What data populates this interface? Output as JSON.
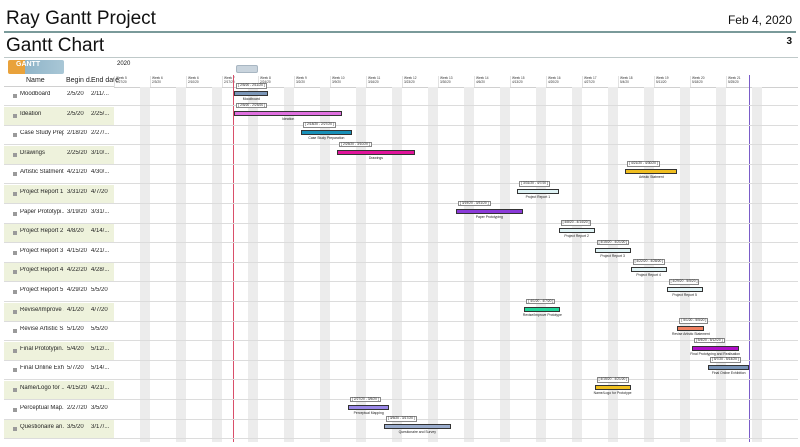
{
  "header": {
    "title": "Ray Gantt Project",
    "date": "Feb 4, 2020",
    "subtitle": "Gantt Chart",
    "page": "3"
  },
  "chart": {
    "logo_text": "GANTT",
    "year": "2020",
    "col_name": "Name",
    "col_begin": "Begin d...",
    "col_end": "End date",
    "weeks": [
      "Week 5",
      "Week 6",
      "Week 6",
      "Week 7",
      "Week 8",
      "Week 9",
      "Week 10",
      "Week 11",
      "Week 12",
      "Week 13",
      "Week 14",
      "Week 15",
      "Week 16",
      "Week 17",
      "Week 18",
      "Week 19",
      "Week 20",
      "Week 21"
    ],
    "week_dates": [
      "1/27/20",
      "2/3/20",
      "2/10/20",
      "2/17/20",
      "2/24/20",
      "3/2/20",
      "3/9/20",
      "3/16/20",
      "3/23/20",
      "3/30/20",
      "4/6/20",
      "4/13/20",
      "4/20/20",
      "4/27/20",
      "5/4/20",
      "5/11/20",
      "5/18/20",
      "5/25/20"
    ],
    "today_line_color": "#d94f6a",
    "end_line_color": "#7a5cc8",
    "tasks": [
      {
        "name": "Moodboard",
        "begin": "2/5/20",
        "end": "2/11/...",
        "range": "[ 2/5/20 - 2/11/20 ]",
        "label": "Moodboard",
        "color": "#7b96b8",
        "start": 3.34,
        "dur": 0.95
      },
      {
        "name": "Ideation",
        "begin": "2/5/20",
        "end": "2/25/...",
        "range": "[ 2/5/20 - 2/25/20 ]",
        "label": "Ideation",
        "color": "#e070e0",
        "start": 3.34,
        "dur": 3.0
      },
      {
        "name": "Case Study Prep...",
        "begin": "2/18/20",
        "end": "2/27/...",
        "range": "[ 2/18/20 - 2/27/20 ]",
        "label": "Case Study Preparation",
        "color": "#1890b8",
        "start": 5.2,
        "dur": 1.4
      },
      {
        "name": "Drawings",
        "begin": "2/25/20",
        "end": "3/10/...",
        "range": "[ 2/25/20 - 3/10/20 ]",
        "label": "Drawings",
        "color": "#e0139a",
        "start": 6.2,
        "dur": 2.15
      },
      {
        "name": "Artistic Statment",
        "begin": "4/21/20",
        "end": "4/30/...",
        "range": "[ 4/21/20 - 4/30/20 ]",
        "label": "Artistic Statment",
        "color": "#f0be20",
        "start": 14.2,
        "dur": 1.45
      },
      {
        "name": "Project Report 1",
        "begin": "3/31/20",
        "end": "4/7/20",
        "range": "[ 3/31/20 - 4/7/20 ]",
        "label": "Project Report 1",
        "color": "#dff3f5",
        "start": 11.2,
        "dur": 1.15
      },
      {
        "name": "Paper Prototypi...",
        "begin": "3/19/20",
        "end": "3/31/...",
        "range": "[ 3/19/20 - 3/31/20 ]",
        "label": "Paper Prototyping",
        "color": "#8a3ad8",
        "start": 9.5,
        "dur": 1.85
      },
      {
        "name": "Project Report 2",
        "begin": "4/8/20",
        "end": "4/14/...",
        "range": "[ 4/8/20 - 4/14/20 ]",
        "label": "Project Report 2",
        "color": "#dff3f5",
        "start": 12.35,
        "dur": 1.0
      },
      {
        "name": "Project Report 3",
        "begin": "4/15/20",
        "end": "4/21/...",
        "range": "[ 4/15/20 - 4/21/20 ]",
        "label": "Project Report 3",
        "color": "#dff3f5",
        "start": 13.35,
        "dur": 1.0
      },
      {
        "name": "Project Report 4",
        "begin": "4/22/20",
        "end": "4/28/...",
        "range": "[ 4/22/20 - 4/28/20 ]",
        "label": "Project Report 4",
        "color": "#dff3f5",
        "start": 14.35,
        "dur": 1.0
      },
      {
        "name": "Project Report 5",
        "begin": "4/29/20",
        "end": "5/5/20",
        "range": "[ 4/29/20 - 5/5/20 ]",
        "label": "Project Report 5",
        "color": "#dff3f5",
        "start": 15.35,
        "dur": 1.0
      },
      {
        "name": "Revise/Improve ...",
        "begin": "4/1/20",
        "end": "4/7/20",
        "range": "[ 4/1/20 - 4/7/20 ]",
        "label": "Revise/Improve Prototype",
        "color": "#22d69a",
        "start": 11.4,
        "dur": 1.0
      },
      {
        "name": "Revise Artistic S...",
        "begin": "5/1/20",
        "end": "5/5/20",
        "range": "[ 5/1/20 - 5/5/20 ]",
        "label": "Revise Artistic Statement",
        "color": "#f08060",
        "start": 15.65,
        "dur": 0.75
      },
      {
        "name": "Final Prototypin...",
        "begin": "5/4/20",
        "end": "5/12/...",
        "range": "[ 5/4/20 - 5/12/20 ]",
        "label": "Final Prototyping and Realisation",
        "color": "#b010c8",
        "start": 16.05,
        "dur": 1.3
      },
      {
        "name": "Final Online Exh...",
        "begin": "5/7/20",
        "end": "5/14/...",
        "range": "[ 5/7/20 - 5/14/20 ]",
        "label": "Final Online Exhibition",
        "color": "#7b96b8",
        "start": 16.5,
        "dur": 1.15
      },
      {
        "name": "Name/Logo for ...",
        "begin": "4/15/20",
        "end": "4/21/...",
        "range": "[ 4/15/20 - 4/21/20 ]",
        "label": "Name/Logo for Prototype",
        "color": "#f0c020",
        "start": 13.35,
        "dur": 1.0
      },
      {
        "name": "Perceptual Map...",
        "begin": "2/27/20",
        "end": "3/5/20",
        "range": "[ 2/27/20 - 3/5/20 ]",
        "label": "Perceptual Mapping",
        "color": "#9a88e8",
        "start": 6.5,
        "dur": 1.15
      },
      {
        "name": "Questionaire an...",
        "begin": "3/5/20",
        "end": "3/17/...",
        "range": "[ 3/5/20 - 3/17/20 ]",
        "label": "Questionaire and Survey",
        "color": "#9aaccc",
        "start": 7.5,
        "dur": 1.85
      }
    ]
  }
}
